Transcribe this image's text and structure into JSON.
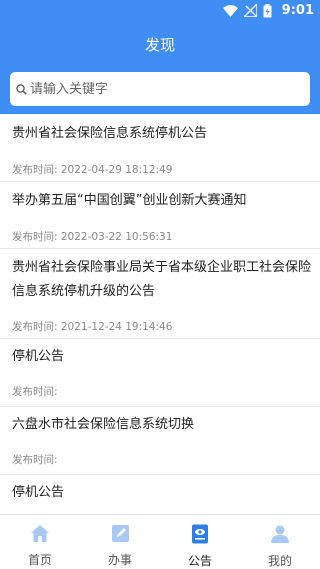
{
  "status_bar": {
    "time": "9:01"
  },
  "header": {
    "title": "发现"
  },
  "search": {
    "placeholder": "请输入关键字"
  },
  "announcements": [
    {
      "title": "贵州省社会保险信息系统停机公告",
      "time": "发布时间: 2022-04-29 18:12:49"
    },
    {
      "title": "举办第五届“中国创翼”创业创新大赛通知",
      "time": "发布时间: 2022-03-22 10:56:31"
    },
    {
      "title": "贵州省社会保险事业局关于省本级企业职工社会保险信息系统停机升级的公告",
      "time": "发布时间: 2021-12-24 19:14:46"
    },
    {
      "title": "停机公告",
      "time": "发布时间:"
    },
    {
      "title": "六盘水市社会保险信息系统切换",
      "time": "发布时间:"
    },
    {
      "title": "停机公告",
      "time": ""
    }
  ],
  "tabbar": {
    "items": [
      {
        "label": "首页",
        "icon": "home-icon",
        "active": false
      },
      {
        "label": "办事",
        "icon": "edit-icon",
        "active": false
      },
      {
        "label": "公告",
        "icon": "notice-icon",
        "active": true
      },
      {
        "label": "我的",
        "icon": "user-icon",
        "active": false
      }
    ]
  },
  "colors": {
    "primary": "#3f8ef5",
    "tab_icon_inactive": "#a9c8f3",
    "tab_icon_active": "#2f7fe8"
  }
}
